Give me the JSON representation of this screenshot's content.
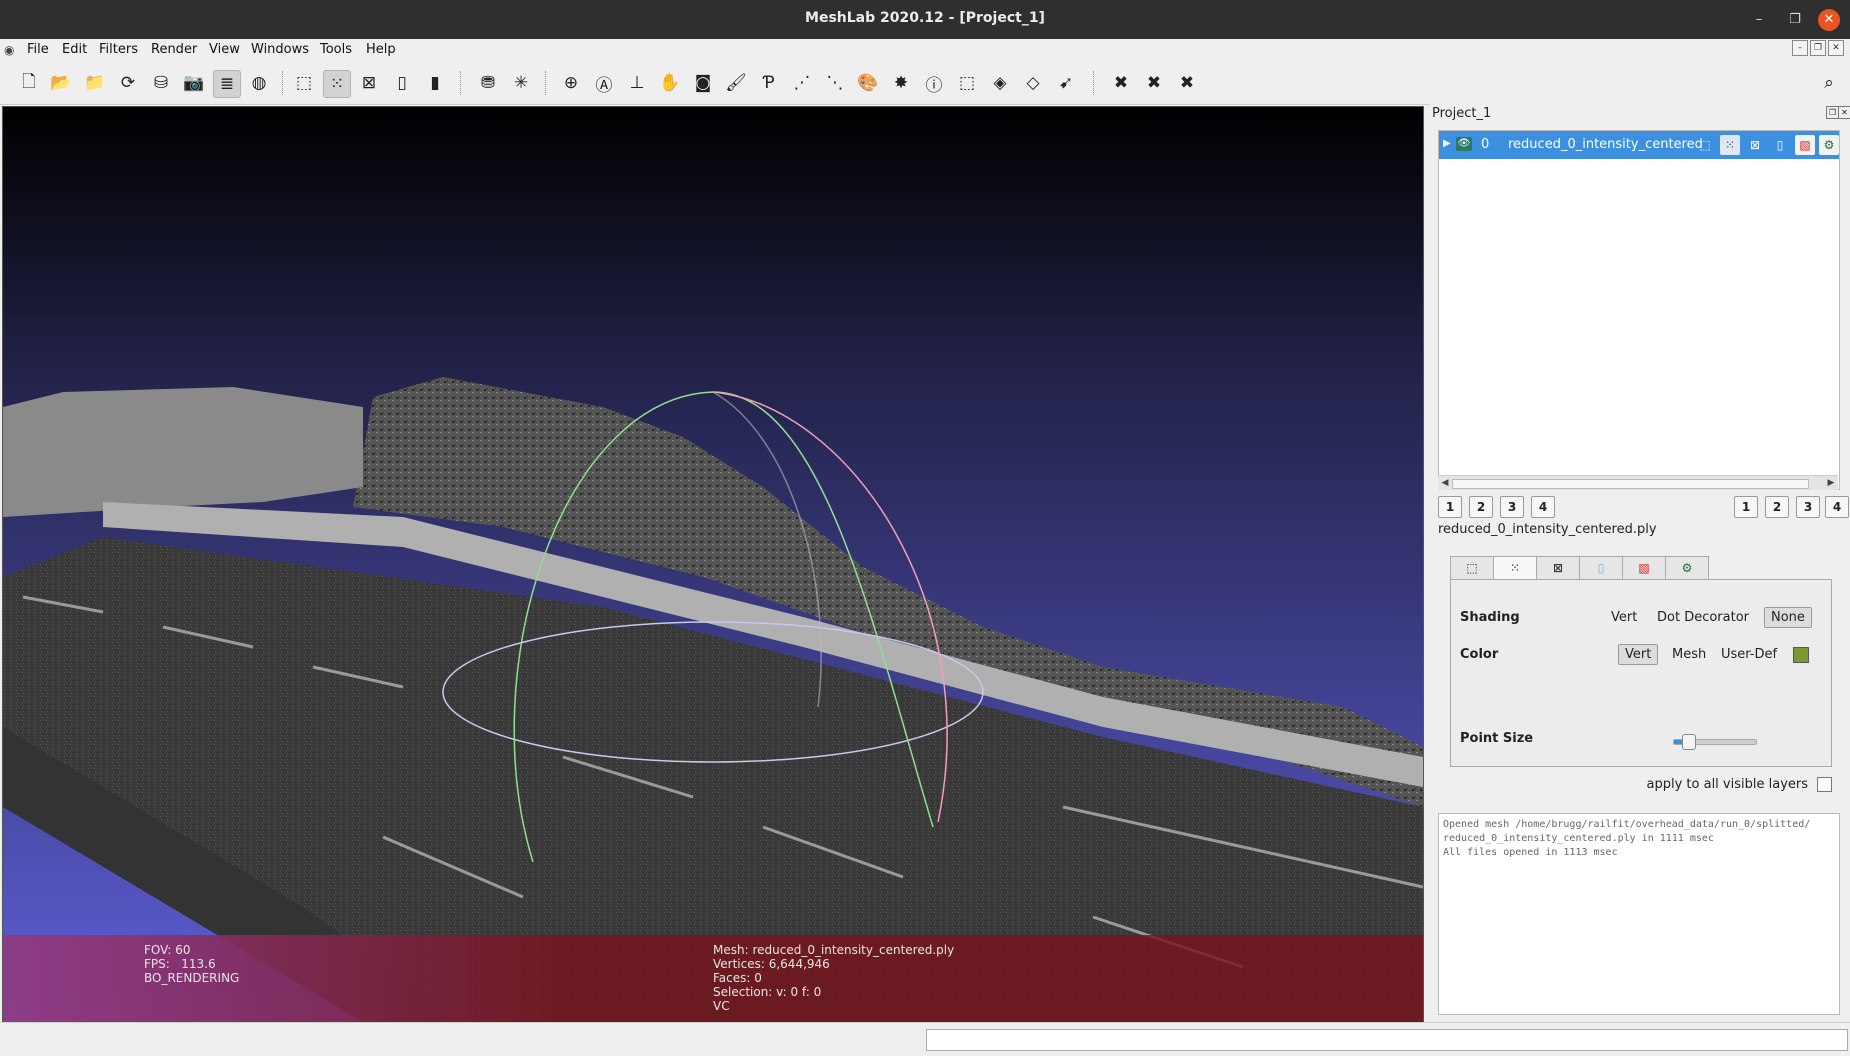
{
  "window": {
    "title": "MeshLab 2020.12 - [Project_1]",
    "minimize": "–",
    "restore": "❐",
    "close": "✕"
  },
  "menu": [
    "File",
    "Edit",
    "Filters",
    "Render",
    "View",
    "Windows",
    "Tools",
    "Help"
  ],
  "viewport": {
    "fov": "FOV: 60",
    "fps": "FPS:   113.6",
    "rendering": "BO_RENDERING",
    "mesh": "Mesh: reduced_0_intensity_centered.ply",
    "vertices": "Vertices: 6,644,946",
    "faces": "Faces: 0",
    "selection": "Selection: v: 0 f: 0",
    "color_mode": "VC"
  },
  "layers_panel": {
    "title": "Project_1",
    "layers": [
      {
        "index": "0",
        "name": "reduced_0_intensity_centered"
      }
    ],
    "left_buttons": [
      "1",
      "2",
      "3",
      "4"
    ],
    "right_buttons": [
      "1",
      "2",
      "3",
      "4"
    ]
  },
  "render_props": {
    "mesh_name": "reduced_0_intensity_centered.ply",
    "shading_label": "Shading",
    "shading_options": [
      "Vert",
      "Dot Decorator",
      "None"
    ],
    "shading_selected": "None",
    "color_label": "Color",
    "color_options": [
      "Vert",
      "Mesh",
      "User-Def"
    ],
    "color_selected": "Vert",
    "user_color": "#7a9a30",
    "point_size_label": "Point Size",
    "point_size_value": 0.17,
    "apply_label": "apply to all visible layers"
  },
  "log": [
    "Opened mesh /home/brugg/railfit/overhead_data/run_0/splitted/",
    "reduced_0_intensity_centered.ply in 1111 msec",
    "All files opened in 1113 msec"
  ],
  "colors": {
    "accent": "#3d8fe0",
    "close_button": "#e95420"
  }
}
